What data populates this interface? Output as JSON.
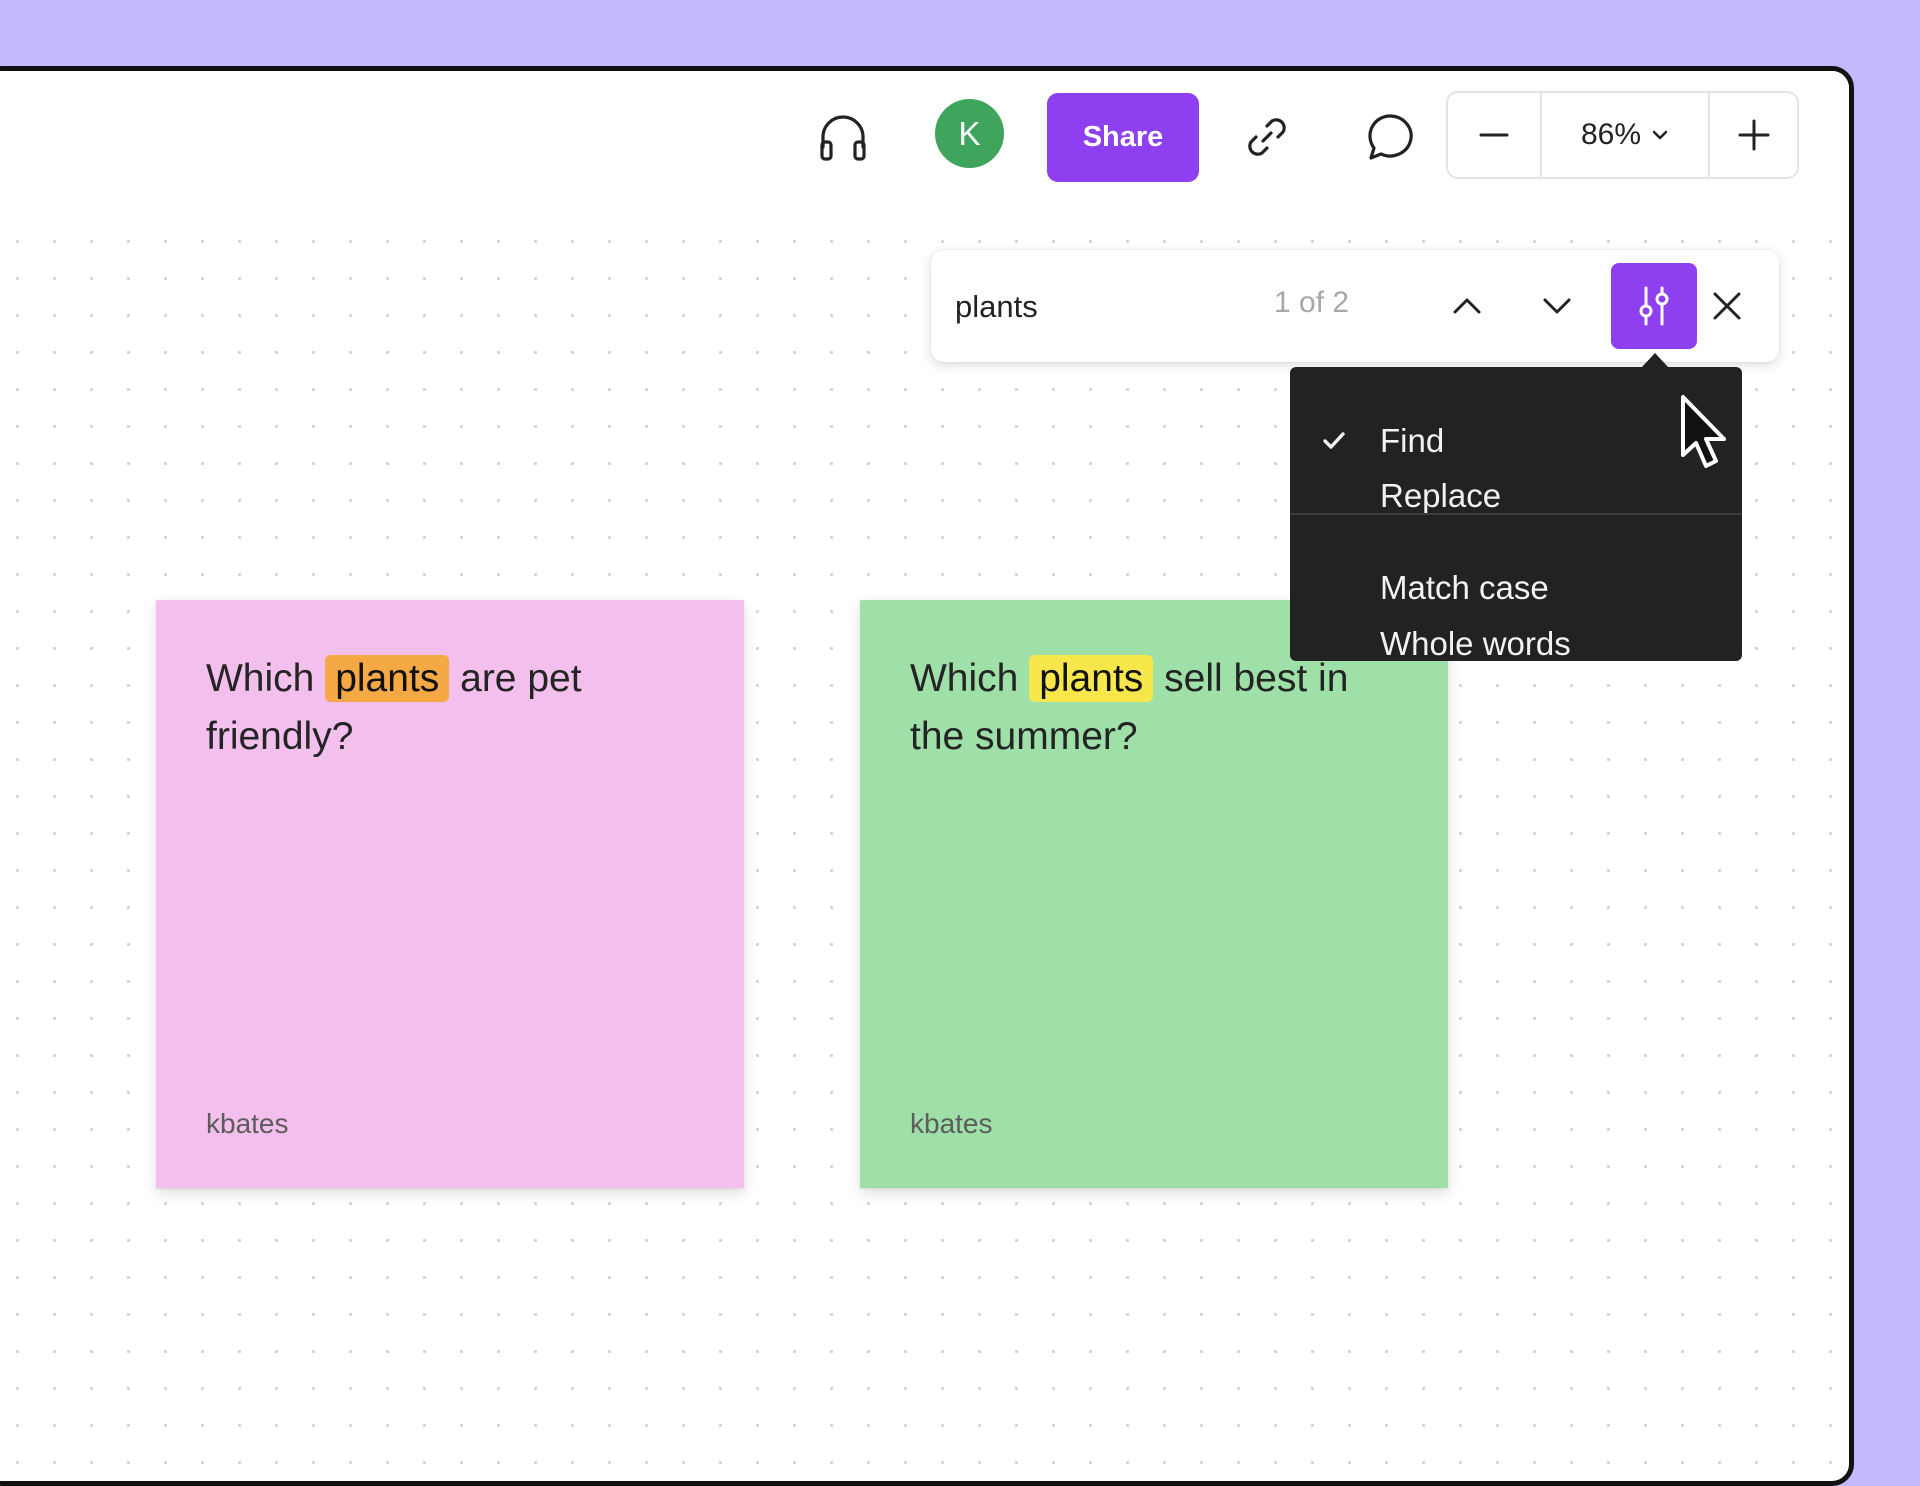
{
  "toolbar": {
    "audio_icon": "headphones-icon",
    "avatar_initial": "K",
    "share_label": "Share",
    "link_icon": "link-icon",
    "comment_icon": "comment-icon",
    "zoom_minus_icon": "minus-icon",
    "zoom_level": "86%",
    "zoom_plus_icon": "plus-icon"
  },
  "find_bar": {
    "query": "plants",
    "match_count": "1 of 2",
    "prev_icon": "chevron-up-icon",
    "next_icon": "chevron-down-icon",
    "options_icon": "sliders-icon",
    "close_icon": "close-icon"
  },
  "find_options_menu": {
    "items": [
      {
        "label": "Find",
        "checked": true
      },
      {
        "label": "Replace",
        "checked": false
      },
      {
        "label": "Match case",
        "checked": false
      },
      {
        "label": "Whole words",
        "checked": false
      }
    ]
  },
  "stickies": [
    {
      "text_before": "Which",
      "highlight": "plants",
      "text_after": "are pet friendly?",
      "author": "kbates",
      "color": "#f3bfec",
      "highlight_color": "#f4a944"
    },
    {
      "text_before": "Which",
      "highlight": "plants",
      "text_after": "sell best in the summer?",
      "author": "kbates",
      "color": "#9ee0a8",
      "highlight_color": "#f7e74a"
    }
  ],
  "colors": {
    "accent": "#8e3ff0",
    "background": "#c5b8fc",
    "avatar": "#3fa45c",
    "menu_bg": "#222222"
  }
}
